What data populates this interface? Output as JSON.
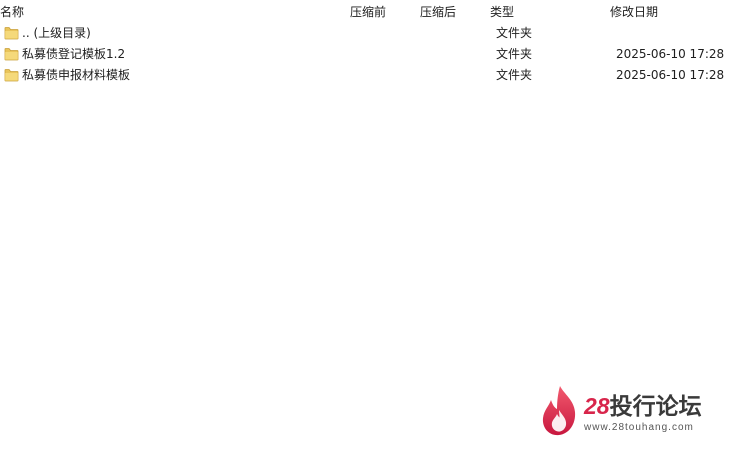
{
  "columns": {
    "name": "名称",
    "size_before": "压缩前",
    "size_after": "压缩后",
    "type": "类型",
    "modified": "修改日期"
  },
  "rows": [
    {
      "icon": "folder-icon",
      "name": ".. (上级目录)",
      "type": "文件夹",
      "modified": ""
    },
    {
      "icon": "folder-icon",
      "name": "私募债登记模板1.2",
      "type": "文件夹",
      "modified": "2025-06-10 17:28"
    },
    {
      "icon": "folder-icon",
      "name": "私募债申报材料模板",
      "type": "文件夹",
      "modified": "2025-06-10 17:28"
    }
  ],
  "watermark": {
    "brand_number": "28",
    "brand_text": "投行论坛",
    "url": "www.28touhang.com"
  },
  "colors": {
    "folder": "#e9c45a",
    "brand_red": "#d8254b"
  }
}
